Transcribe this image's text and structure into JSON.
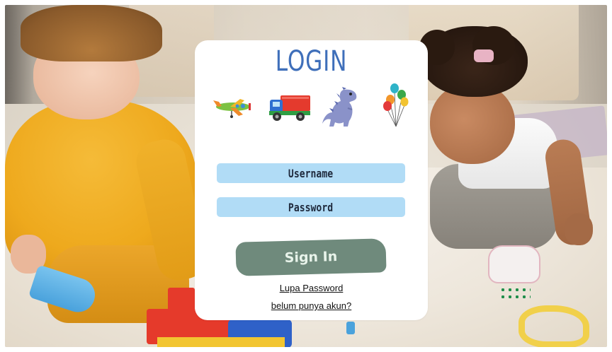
{
  "login": {
    "title": "LOGIN",
    "username_label": "Username",
    "password_label": "Password",
    "signin_label": "Sign In",
    "forgot_password_link": "Lupa Password",
    "register_link": "belum punya akun?"
  },
  "icons": [
    "airplane-icon",
    "truck-icon",
    "dinosaur-icon",
    "balloons-icon"
  ],
  "colors": {
    "title": "#3f6fba",
    "field_bg": "#b1dcf6",
    "button_bg": "#6f8a7c",
    "button_text": "#e8f3ea",
    "card_bg": "#ffffff"
  }
}
